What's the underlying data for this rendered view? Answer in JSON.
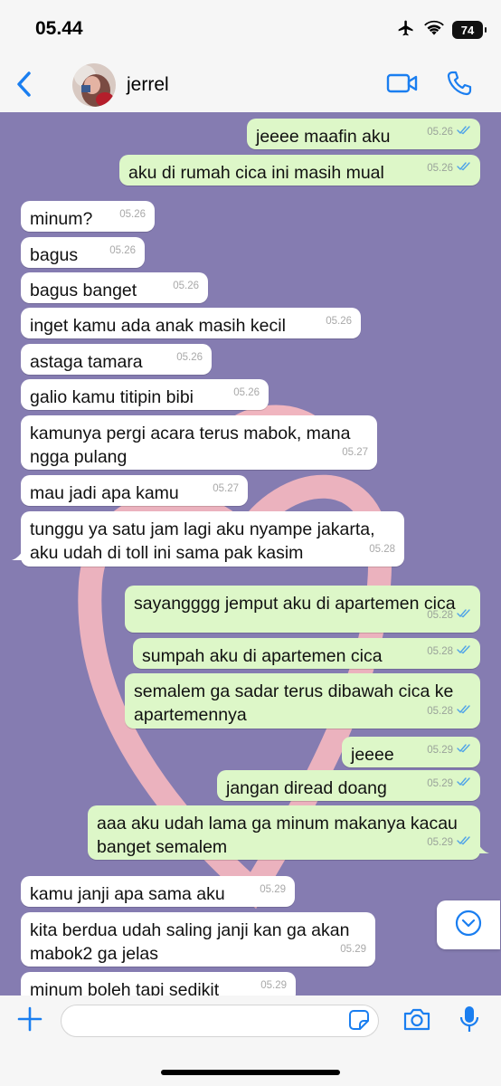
{
  "status_bar": {
    "time": "05.44",
    "battery": "74"
  },
  "header": {
    "contact_name": "jerrel"
  },
  "messages": [
    {
      "dir": "out",
      "lines": [
        "jeeee maafin aku"
      ],
      "time": "05.26"
    },
    {
      "dir": "out",
      "lines": [
        "aku di rumah cica ini masih mual"
      ],
      "time": "05.26"
    },
    {
      "dir": "in",
      "lines": [
        "minum?"
      ],
      "time": "05.26"
    },
    {
      "dir": "in",
      "lines": [
        "bagus"
      ],
      "time": "05.26"
    },
    {
      "dir": "in",
      "lines": [
        "bagus banget"
      ],
      "time": "05.26"
    },
    {
      "dir": "in",
      "lines": [
        "inget kamu ada anak masih kecil"
      ],
      "time": "05.26"
    },
    {
      "dir": "in",
      "lines": [
        "astaga tamara"
      ],
      "time": "05.26"
    },
    {
      "dir": "in",
      "lines": [
        "galio kamu titipin bibi"
      ],
      "time": "05.26"
    },
    {
      "dir": "in",
      "lines": [
        "kamunya pergi acara terus mabok, mana",
        "ngga pulang"
      ],
      "time": "05.27"
    },
    {
      "dir": "in",
      "lines": [
        "mau jadi apa kamu"
      ],
      "time": "05.27"
    },
    {
      "dir": "in",
      "lines": [
        "tunggu ya satu jam lagi aku nyampe jakarta,",
        "aku udah di toll ini sama pak kasim"
      ],
      "time": "05.28"
    },
    {
      "dir": "out",
      "lines": [
        "sayangggg jemput aku di apartemen cica"
      ],
      "time": "05.28"
    },
    {
      "dir": "out",
      "lines": [
        "sumpah aku di apartemen cica"
      ],
      "time": "05.28"
    },
    {
      "dir": "out",
      "lines": [
        "semalem ga sadar terus dibawah cica ke",
        "apartemennya"
      ],
      "time": "05.28"
    },
    {
      "dir": "out",
      "lines": [
        "jeeee"
      ],
      "time": "05.29"
    },
    {
      "dir": "out",
      "lines": [
        "jangan diread doang"
      ],
      "time": "05.29"
    },
    {
      "dir": "out",
      "lines": [
        "aaa aku udah lama ga minum makanya kacau",
        "banget semalem"
      ],
      "time": "05.29"
    },
    {
      "dir": "in",
      "lines": [
        "kamu janji apa sama aku"
      ],
      "time": "05.29"
    },
    {
      "dir": "in",
      "lines": [
        "kita berdua udah saling janji kan ga akan",
        "mabok2 ga jelas"
      ],
      "time": "05.29"
    },
    {
      "dir": "in",
      "lines": [
        "minum boleh tapi sedikit"
      ],
      "time": "05.29"
    }
  ],
  "input": {
    "value": ""
  },
  "icons": {
    "back": "chevron-left-icon",
    "video": "video-camera-icon",
    "call": "phone-icon",
    "add": "plus-icon",
    "sticker": "sticker-icon",
    "camera": "camera-icon",
    "mic": "microphone-icon",
    "scroll": "chevron-down-circle-icon"
  },
  "colors": {
    "accent": "#1a7ef0",
    "chat_bg": "#857cb1",
    "outgoing_bubble": "#ddf7c8",
    "incoming_bubble": "#ffffff",
    "read_ticks": "#4fa3e8",
    "wallpaper_heart": "#f0b5bf"
  }
}
